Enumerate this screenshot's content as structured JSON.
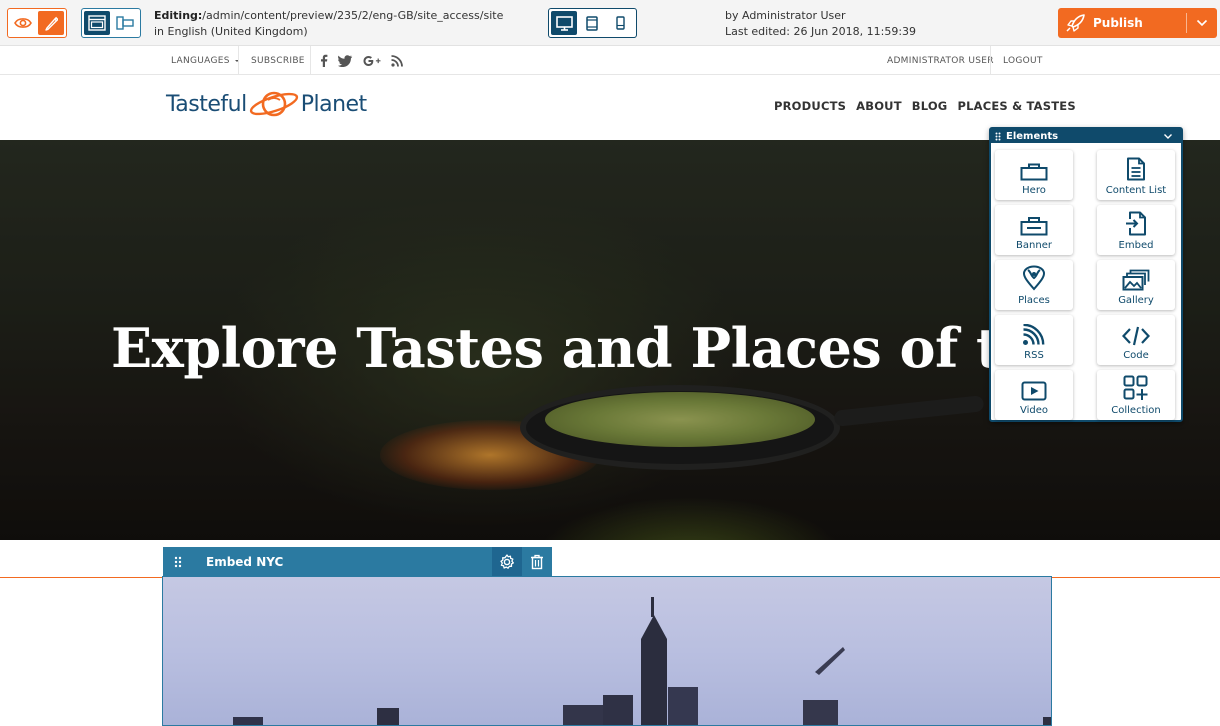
{
  "editor": {
    "editing_label": "Editing:",
    "editing_path": "/admin/content/preview/235/2/eng-GB/site_access/site",
    "language_line": "in English (United Kingdom)",
    "author_line": "by Administrator User",
    "edited_line": "Last edited: 26 Jun 2018, 11:59:39",
    "publish_label": "Publish",
    "accent_color": "#f26a21",
    "primary_color": "#0f4a6b"
  },
  "site": {
    "strip": {
      "languages": "LANGUAGES",
      "subscribe": "SUBSCRIBE",
      "user": "ADMINISTRATOR USER",
      "logout": "LOGOUT"
    },
    "logo_left": "Tasteful",
    "logo_right": "Planet",
    "nav": [
      "PRODUCTS",
      "ABOUT",
      "BLOG",
      "PLACES & TASTES"
    ],
    "hero_title": "Explore Tastes and Places of the W"
  },
  "embed": {
    "title": "Embed NYC"
  },
  "elements_panel": {
    "title": "Elements",
    "items": [
      {
        "label": "Hero",
        "icon": "hero-icon"
      },
      {
        "label": "Content List",
        "icon": "content-list-icon"
      },
      {
        "label": "Banner",
        "icon": "banner-icon"
      },
      {
        "label": "Embed",
        "icon": "embed-icon"
      },
      {
        "label": "Places",
        "icon": "places-icon"
      },
      {
        "label": "Gallery",
        "icon": "gallery-icon"
      },
      {
        "label": "RSS",
        "icon": "rss-icon"
      },
      {
        "label": "Code",
        "icon": "code-icon"
      },
      {
        "label": "Video",
        "icon": "video-icon"
      },
      {
        "label": "Collection",
        "icon": "collection-icon"
      }
    ]
  }
}
